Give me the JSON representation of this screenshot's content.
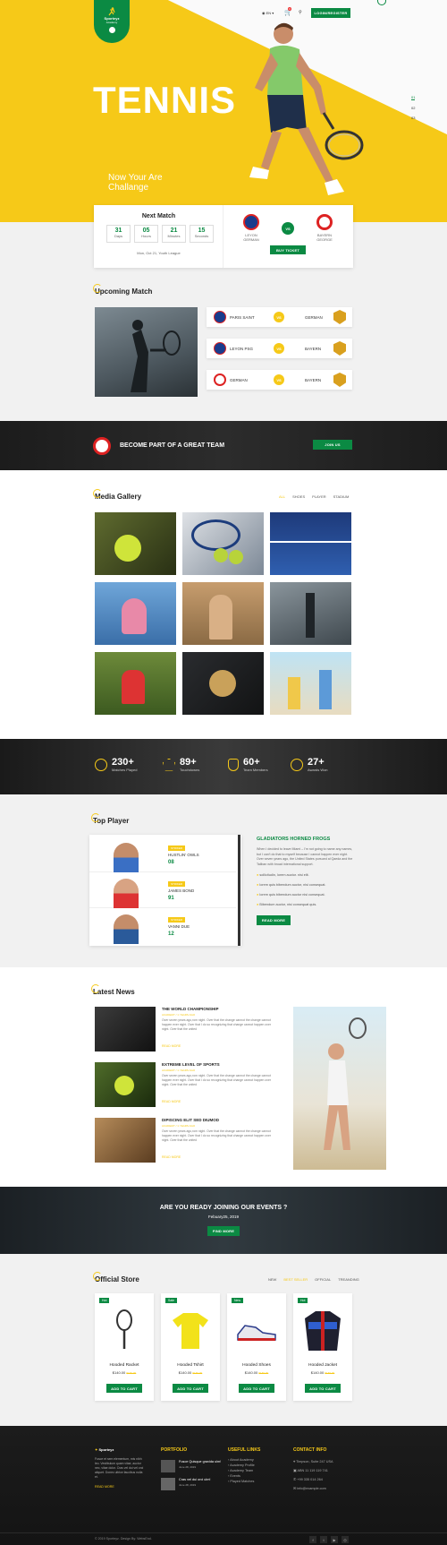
{
  "header": {
    "logo_text": "Sporteyz",
    "logo_sub": "Academy",
    "lang": "EN",
    "login_label": "LOGIN/REGISTER",
    "cart_count": "0",
    "slider_dots": [
      "01",
      "02",
      "03"
    ]
  },
  "hero": {
    "title": "TENNIS",
    "subtitle_line1": "Now Your Are",
    "subtitle_line2": "Challange"
  },
  "next_match": {
    "title": "Next Match",
    "countdown": [
      {
        "value": "31",
        "unit": "Days"
      },
      {
        "value": "05",
        "unit": "Hours"
      },
      {
        "value": "21",
        "unit": "Minutes"
      },
      {
        "value": "15",
        "unit": "Seconds"
      }
    ],
    "date": "Mon, Oct 21, Youth League",
    "team1_line1": "LEYON",
    "team1_line2": "GERMAN",
    "vs": "VS",
    "team2_line1": "BAYERN",
    "team2_line2": "GEORGE",
    "ticket_label": "BUY TICKET"
  },
  "upcoming": {
    "title": "Upcoming Match",
    "rows": [
      {
        "left": "PARIS SAINT",
        "vs": "VS",
        "right": "GERMAN"
      },
      {
        "left": "LEYON PSG",
        "vs": "VS",
        "right": "BAYERN"
      },
      {
        "left": "GERMAN",
        "vs": "VS",
        "right": "BAYERN"
      }
    ]
  },
  "join_banner": {
    "text": "BECOME PART OF A GREAT TEAM",
    "button": "JOIN US"
  },
  "gallery": {
    "title": "Media Gallery",
    "tabs": [
      "ALL",
      "SHOES",
      "PLAYER",
      "STADIUM"
    ]
  },
  "stats": [
    {
      "value": "230+",
      "label": "Matches Played"
    },
    {
      "value": "89+",
      "label": "Touchdowns"
    },
    {
      "value": "60+",
      "label": "Team Members"
    },
    {
      "value": "27+",
      "label": "Awards Won"
    }
  ],
  "top_player": {
    "title": "Top Player",
    "players": [
      {
        "tag": "STRIKER",
        "name": "HUSTLIN' OWLS",
        "num": "08"
      },
      {
        "tag": "STRIKER",
        "name": "JAMES BOND",
        "num": "91"
      },
      {
        "tag": "STRIKER",
        "name": "VANNI DUE",
        "num": "12"
      }
    ],
    "info_title": "GLADIATORS HORNED FROGS",
    "info_text": "When I decided to leave Miami – I'm not going to name any names, but I can't do that to myself because I cannot happen ever night. Over seven years ago, the United States pursued al Qaeda and the Taliban with broad international support.",
    "bullets": [
      "sollicitudin, lorem auctor. nisi elit.",
      "lorem quis bibendum auctor, nisi consequat.",
      "lorem quis bibendum auctor nisi consequat.",
      "Bibendum auctor, nisi consequat quis."
    ],
    "button": "READ MORE"
  },
  "news": {
    "title": "Latest News",
    "items": [
      {
        "title": "THE WORLD CHAMPIONSHIP",
        "meta": "ACADEMY / 1 YEARS AGO",
        "text": "Over seven years ago,rom night. Over that the change cannot the change cannot happen ever night. Over that I do so recognizing that change cannot happen over night. Over that the united",
        "more": "READ MORE"
      },
      {
        "title": "EXTREME LEVEL OF SPORTS",
        "meta": "ACADEMY / 1 YEARS AGO",
        "text": "Over seven years ago,rom night. Over that the change cannot the change cannot happen ever night. Over that I do so recognizing that change cannot happen over night. Over that the united",
        "more": "READ MORE"
      },
      {
        "title": "DIPISCING ELIT SED DIUMOD",
        "meta": "ACADEMY / 1 YEARS AGO",
        "text": "Over seven years ago,rom night. Over that the change cannot the change cannot happen ever night. Over that I do so recognizing that change cannot happen over night. Over that the united",
        "more": "READ MORE"
      }
    ]
  },
  "events": {
    "title": "ARE YOU READY JOINING OUR EVENTS ?",
    "date": "Febuary25, 2019",
    "button": "FIND MORE"
  },
  "store": {
    "title": "Official Store",
    "tabs": [
      "NEW",
      "BEST SELLER",
      "OFFICIAL",
      "TREANDING"
    ],
    "products": [
      {
        "badge": "Hot",
        "name": "Hooded Racket",
        "price": "$140.00",
        "old": "$160.00",
        "button": "ADD TO CART"
      },
      {
        "badge": "Sale",
        "name": "Hooded Tshirt",
        "price": "$140.00",
        "old": "$160.00",
        "button": "ADD TO CART"
      },
      {
        "badge": "New",
        "name": "Hooded Shoes",
        "price": "$140.00",
        "old": "$160.00",
        "button": "ADD TO CART"
      },
      {
        "badge": "Hot",
        "name": "Hooded Jacket",
        "price": "$140.00",
        "old": "$160.00",
        "button": "ADD TO CART"
      }
    ]
  },
  "footer": {
    "about": "Fusce et sem elementum, mis nibh leo. Vestibulum quam vitae, auctor nec, vitae dolor. Cras vel dui vel orci aliquet. Donec ultrice faucibus nulla et.",
    "about_more": "READ MORE",
    "portfolio_h": "PORTFOLIO",
    "portfolio": [
      {
        "title": "Fusce Quisque gravida ulm!",
        "date": "June 28, 2019"
      },
      {
        "title": "Cras vel dui orci ulm!",
        "date": "June 28, 2019"
      }
    ],
    "links_h": "USEFUL LINKS",
    "links": [
      "About Academy",
      "Academy Profile",
      "Academy Team",
      "Events",
      "Played Matches"
    ],
    "contact_h": "CONTACT INFO",
    "contact": [
      "Timpson, Suite 247 USA",
      "ABN 11 119 119 741",
      "+99 335 014 264",
      "info@example.com"
    ],
    "copyright": "© 2019 Sporteyz. Design By: WebsEnd."
  },
  "colors": {
    "yellow": "#f6c918",
    "green": "#0b8a43",
    "dark": "#222222"
  }
}
